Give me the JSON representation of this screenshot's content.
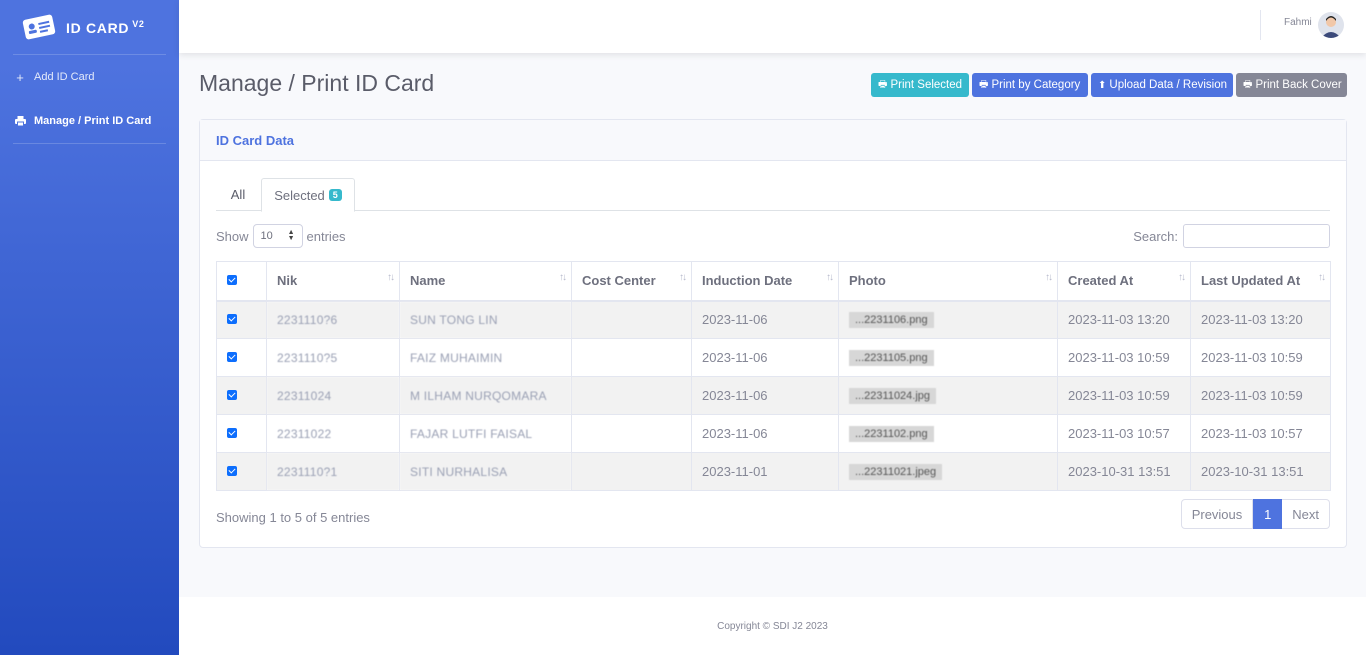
{
  "brand": {
    "name": "ID CARD",
    "version": "V2"
  },
  "sidebar": {
    "items": [
      {
        "label": "Add ID Card",
        "icon": "plus-icon"
      },
      {
        "label": "Manage / Print ID Card",
        "icon": "printer-icon"
      }
    ]
  },
  "topbar": {
    "user_name": "Fahmi"
  },
  "page": {
    "title": "Manage / Print ID Card"
  },
  "actions": {
    "print_selected": "Print Selected",
    "print_by_category": "Print by Category",
    "upload_data": "Upload Data / Revision",
    "print_back_cover": "Print Back Cover"
  },
  "card": {
    "title": "ID Card Data",
    "tabs": {
      "all": "All",
      "selected": "Selected",
      "selected_count": "5"
    },
    "length": {
      "show": "Show",
      "value": "10",
      "entries": "entries"
    },
    "search_label": "Search:",
    "columns": [
      "Nik",
      "Name",
      "Cost Center",
      "Induction Date",
      "Photo",
      "Created At",
      "Last Updated At"
    ],
    "rows": [
      {
        "nik": "2231110?6",
        "name": "SUN TONG LIN",
        "cost_center": "",
        "induction": "2023-11-06",
        "photo": "...2231106.png",
        "created": "2023-11-03 13:20",
        "updated": "2023-11-03 13:20"
      },
      {
        "nik": "2231110?5",
        "name": "FAIZ MUHAIMIN",
        "cost_center": "",
        "induction": "2023-11-06",
        "photo": "...2231105.png",
        "created": "2023-11-03 10:59",
        "updated": "2023-11-03 10:59"
      },
      {
        "nik": "22311024",
        "name": "M ILHAM NURQOMARA",
        "cost_center": "",
        "induction": "2023-11-06",
        "photo": "...22311024.jpg",
        "created": "2023-11-03 10:59",
        "updated": "2023-11-03 10:59"
      },
      {
        "nik": "22311022",
        "name": "FAJAR LUTFI FAISAL",
        "cost_center": "",
        "induction": "2023-11-06",
        "photo": "...2231102.png",
        "created": "2023-11-03 10:57",
        "updated": "2023-11-03 10:57"
      },
      {
        "nik": "2231110?1",
        "name": "SITI NURHALISA",
        "cost_center": "",
        "induction": "2023-11-01",
        "photo": "...22311021.jpeg",
        "created": "2023-10-31 13:51",
        "updated": "2023-10-31 13:51"
      }
    ],
    "info": "Showing 1 to 5 of 5 entries",
    "pager": {
      "previous": "Previous",
      "current": "1",
      "next": "Next"
    }
  },
  "footer": {
    "copyright": "Copyright © SDI J2 2023"
  },
  "colors": {
    "primary": "#4e73df",
    "info": "#36b9cc",
    "secondary": "#858796"
  }
}
